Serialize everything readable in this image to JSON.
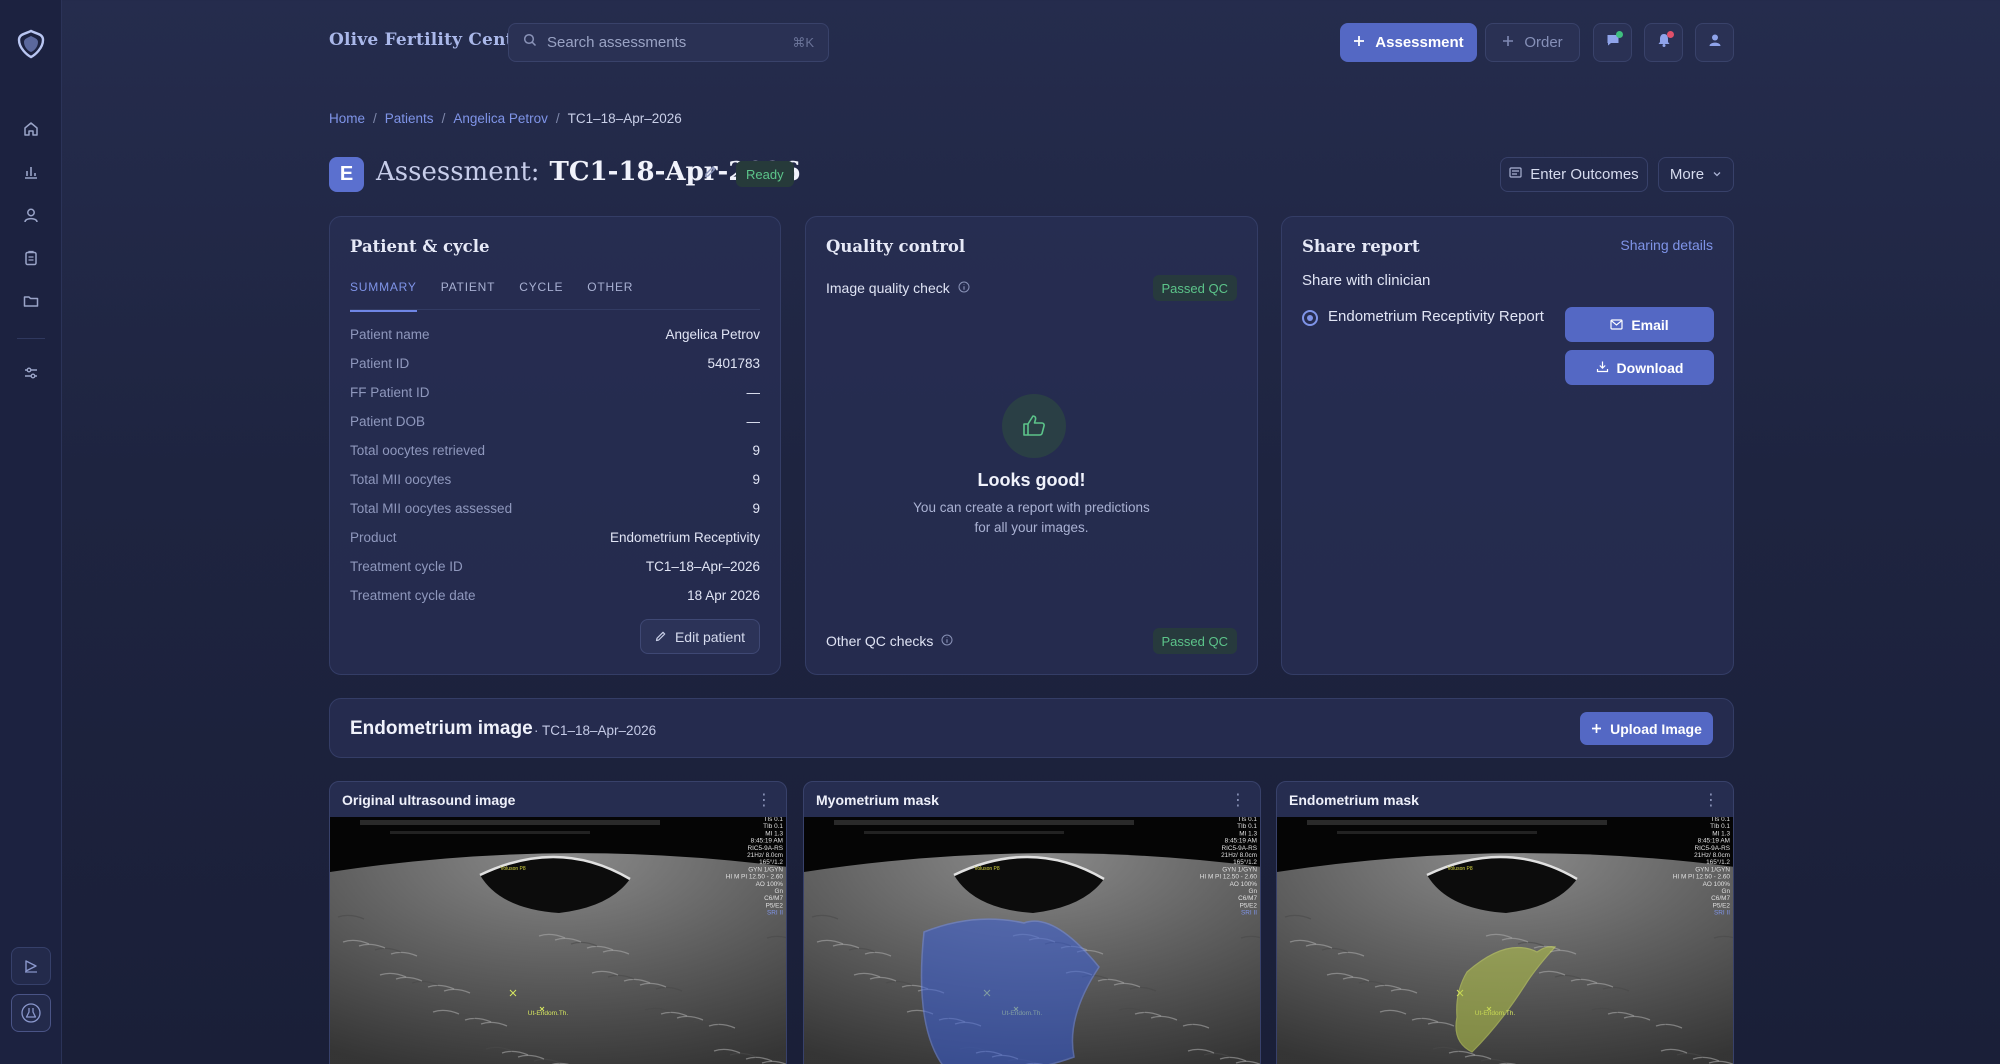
{
  "header": {
    "brand": "Olive Fertility Centre",
    "search_placeholder": "Search assessments",
    "search_shortcut": "⌘K",
    "assessment_button": "Assessment",
    "order_button": "Order"
  },
  "colors": {
    "accent": "#5468c4",
    "success": "#5cc48a",
    "notify_green": "#3fbf7f",
    "notify_red": "#e0506a"
  },
  "icons": [
    "logo-icon",
    "home-icon",
    "chart-icon",
    "user-icon",
    "clipboard-icon",
    "folder-icon",
    "sliders-icon",
    "collapse-icon",
    "flask-icon",
    "search-icon",
    "plus-icon",
    "chat-icon",
    "bell-icon",
    "profile-icon",
    "pencil-icon",
    "list-icon",
    "chevron-down-icon",
    "info-icon",
    "thumbs-up-icon",
    "mail-icon",
    "download-icon",
    "more-vertical-icon"
  ],
  "breadcrumb": {
    "home": "Home",
    "patients": "Patients",
    "patient": "Angelica Petrov",
    "current": "TC1–18–Apr–2026",
    "sep": "/"
  },
  "page": {
    "avatar_letter": "E",
    "title_label": "Assessment:",
    "title_value": "TC1-18-Apr-2026",
    "status": "Ready",
    "enter_outcomes": "Enter Outcomes",
    "more": "More"
  },
  "patient_card": {
    "title": "Patient & cycle",
    "tabs": [
      "SUMMARY",
      "PATIENT",
      "CYCLE",
      "OTHER"
    ],
    "rows": [
      {
        "label": "Patient name",
        "value": "Angelica Petrov"
      },
      {
        "label": "Patient ID",
        "value": "5401783"
      },
      {
        "label": "FF Patient ID",
        "value": "—"
      },
      {
        "label": "Patient DOB",
        "value": "—"
      },
      {
        "label": "Total oocytes retrieved",
        "value": "9"
      },
      {
        "label": "Total MII oocytes",
        "value": "9"
      },
      {
        "label": "Total MII oocytes assessed",
        "value": "9"
      },
      {
        "label": "Product",
        "value": "Endometrium Receptivity"
      },
      {
        "label": "Treatment cycle ID",
        "value": "TC1–18–Apr–2026"
      },
      {
        "label": "Treatment cycle date",
        "value": "18 Apr 2026"
      }
    ],
    "edit_button": "Edit patient"
  },
  "qc_card": {
    "title": "Quality control",
    "image_check": "Image quality check",
    "image_status": "Passed QC",
    "looks_good": "Looks good!",
    "looks_sub": "You can create a report with predictions for all your images.",
    "other_checks": "Other QC checks",
    "other_status": "Passed QC"
  },
  "share_card": {
    "title": "Share report",
    "details_link": "Sharing details",
    "subtitle": "Share with clinician",
    "report_option": "Endometrium Receptivity Report",
    "email_button": "Email",
    "download_button": "Download"
  },
  "endometrium": {
    "title": "Endometrium image",
    "subtitle": "· TC1–18–Apr–2026",
    "upload_button": "Upload Image",
    "images": [
      {
        "title": "Original ultrasound image"
      },
      {
        "title": "Myometrium mask"
      },
      {
        "title": "Endometrium mask"
      }
    ],
    "annotation": "Ut-Endom.Th.",
    "probe_label": "Voluson P8",
    "overlay": [
      "TIs 0.1",
      "TIb 0.1",
      "MI 1.3",
      "8:45:19 AM",
      "RIC5-9A-RS",
      "21Hz/ 8.0cm",
      "165°/1.2",
      "GYN 1/GYN",
      "HI M PI 12.50 - 2.60",
      "AO 100%",
      "Gn",
      "C6/M7",
      "P5/E2",
      "SRI II"
    ]
  }
}
